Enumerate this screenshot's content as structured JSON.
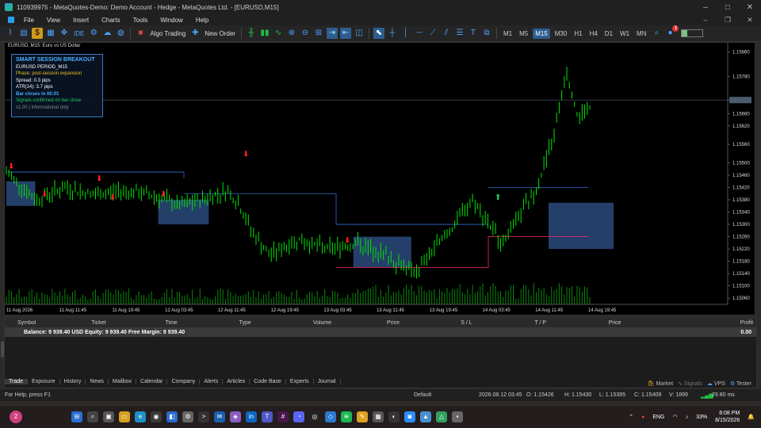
{
  "window": {
    "title": "110939975 - MetaQuotes-Demo: Demo Account - Hedge - MetaQuotes Ltd. - [EURUSD,M15]",
    "min": "–",
    "max": "□",
    "close": "✕"
  },
  "menu": {
    "items": [
      "File",
      "View",
      "Insert",
      "Charts",
      "Tools",
      "Window",
      "Help"
    ]
  },
  "toolbar": {
    "algo_trading": "Algo Trading",
    "new_order": "New Order",
    "ide": "IDE",
    "timeframes": [
      "M1",
      "M5",
      "M15",
      "M30",
      "H1",
      "H4",
      "D1",
      "W1",
      "MN"
    ],
    "active_timeframe": "M15",
    "badge": "1",
    "mini_bar_fraction": 0.25
  },
  "chart": {
    "tab_label": "EURUSD, M15:  Euro vs US Dollar",
    "current_price": "1.15704",
    "price_levels": [
      "1.15860",
      "1.15780",
      "1.15704",
      "1.15660",
      "1.15620",
      "1.15560",
      "1.15500",
      "1.15460",
      "1.15420",
      "1.15380",
      "1.15340",
      "1.15300",
      "1.15260",
      "1.15220",
      "1.15180",
      "1.15140",
      "1.15100",
      "1.15060"
    ],
    "time_labels": [
      "11 Aug 2026",
      "11 Aug 11:45",
      "11 Aug 19:45",
      "12 Aug 03:45",
      "12 Aug 11:45",
      "12 Aug 19:45",
      "13 Aug 03:45",
      "13 Aug 11:45",
      "13 Aug 19:45",
      "14 Aug 03:45",
      "14 Aug 11:45",
      "14 Aug 19:45"
    ],
    "colors": {
      "candle": "#00e600",
      "box": "#2b4a7e",
      "line_blue": "#2f6fd0",
      "line_red": "#ff2a6a",
      "arrow_red": "#ff2020",
      "arrow_green": "#20d060"
    }
  },
  "info_panel": {
    "title": "SMART SESSION BREAKOUT",
    "symbol": "EURUSD  PERIOD_M15",
    "phase": "Phase: post-session expansion",
    "spread": "Spread: 0.3 pips",
    "atr": "ATR(14): 3.7 pips",
    "bar_close": "Bar closes in 00:01",
    "signals": "Signals confirmed on bar close",
    "version": "v1.00 | informational only"
  },
  "toolbox": {
    "label": "Toolbox",
    "columns": [
      "Symbol",
      "Ticket",
      "Time",
      "Type",
      "Volume",
      "Price",
      "S / L",
      "T / P",
      "Price",
      "Profit"
    ],
    "balance_row": "Balance: 9 939.40 USD  Equity: 9 939.40  Free Margin: 9 939.40",
    "profit": "0.00",
    "tabs": [
      "Trade",
      "Exposure",
      "History",
      "News",
      "Mailbox",
      "Calendar",
      "Company",
      "Alerts",
      "Articles",
      "Code Base",
      "Experts",
      "Journal"
    ],
    "active_tab": "Trade",
    "right_tabs": [
      "Market",
      "Signals",
      "VPS",
      "Tester"
    ]
  },
  "status": {
    "help": "For Help, press F1",
    "profile": "Default",
    "time": "2026.08.12 03:45",
    "open": "O: 1.15426",
    "high": "H: 1.15430",
    "low": "L: 1.15395",
    "close": "C: 1.15409",
    "volume": "V: 1899",
    "ping": "29.80 ms"
  },
  "taskbar": {
    "badge": "2",
    "lang": "ENG",
    "time": "8:08 PM",
    "date": "8/15/2026",
    "battery": "33%",
    "app_icons": [
      "windows-icon",
      "search-icon",
      "task-view-icon",
      "file-explorer-icon",
      "edge-icon",
      "chrome-icon",
      "store-icon",
      "settings-icon",
      "terminal-icon",
      "mail-icon",
      "photos-icon",
      "linkedin-icon",
      "teams-icon",
      "slack-icon",
      "discord-icon",
      "github-icon",
      "vscode-icon",
      "spotify-icon",
      "notes-icon",
      "calculator-icon",
      "obs-icon",
      "zoom-icon",
      "metatrader-icon",
      "drive-icon",
      "misc-icon"
    ]
  }
}
